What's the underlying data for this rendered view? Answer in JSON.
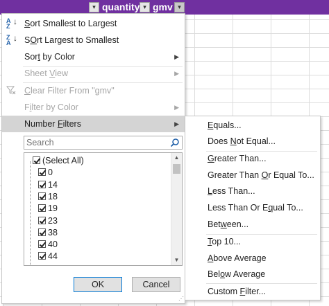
{
  "header": {
    "quantity_label": "quantity",
    "gmv_label": "gmv",
    "dropdown_glyph": "▾",
    "header_color": "#7030a0"
  },
  "menu": {
    "sort_asc": {
      "u": "S",
      "rest": "ort Smallest to Largest",
      "icon_top": "A",
      "icon_bottom": "Z",
      "icon": "sort-ascending-icon"
    },
    "sort_desc": {
      "u": "O",
      "pre": "S",
      "rest": "rt Largest to Smallest",
      "icon_top": "Z",
      "icon_bottom": "A",
      "icon": "sort-descending-icon"
    },
    "sort_color": {
      "pre": "Sor",
      "u": "t",
      "rest": " by Color"
    },
    "sheet_view": {
      "pre": "Sheet ",
      "u": "V",
      "rest": "iew"
    },
    "clear_filter": {
      "pre": "",
      "u": "C",
      "rest": "lear Filter From \"gmv\"",
      "icon": "clear-filter-icon"
    },
    "filter_color": {
      "pre": "F",
      "u": "i",
      "rest": "lter by Color"
    },
    "number_filters": {
      "pre": "Number ",
      "u": "F",
      "rest": "ilters"
    },
    "submenu_arrow": "▶",
    "search_placeholder": "Search",
    "list_items": [
      {
        "label": "(Select All)",
        "checked": true
      },
      {
        "label": "0",
        "checked": true
      },
      {
        "label": "14",
        "checked": true
      },
      {
        "label": "18",
        "checked": true
      },
      {
        "label": "19",
        "checked": true
      },
      {
        "label": "23",
        "checked": true
      },
      {
        "label": "38",
        "checked": true
      },
      {
        "label": "40",
        "checked": true
      },
      {
        "label": "44",
        "checked": true
      }
    ],
    "ok_label": "OK",
    "cancel_label": "Cancel"
  },
  "submenu": {
    "equals": {
      "pre": "",
      "u": "E",
      "rest": "quals..."
    },
    "not_equal": {
      "pre": "Does ",
      "u": "N",
      "rest": "ot Equal..."
    },
    "greater": {
      "pre": "",
      "u": "G",
      "rest": "reater Than..."
    },
    "greater_eq": {
      "pre": "Greater Than ",
      "u": "O",
      "rest": "r Equal To..."
    },
    "less": {
      "pre": "",
      "u": "L",
      "rest": "ess Than..."
    },
    "less_eq": {
      "pre": "Less Than Or E",
      "u": "q",
      "rest": "ual To..."
    },
    "between": {
      "pre": "Bet",
      "u": "w",
      "rest": "een..."
    },
    "top10": {
      "pre": "",
      "u": "T",
      "rest": "op 10..."
    },
    "above_avg": {
      "pre": "",
      "u": "A",
      "rest": "bove Average"
    },
    "below_avg": {
      "pre": "Bel",
      "u": "o",
      "rest": "w Average"
    },
    "custom": {
      "pre": "Custom ",
      "u": "F",
      "rest": "ilter..."
    }
  }
}
